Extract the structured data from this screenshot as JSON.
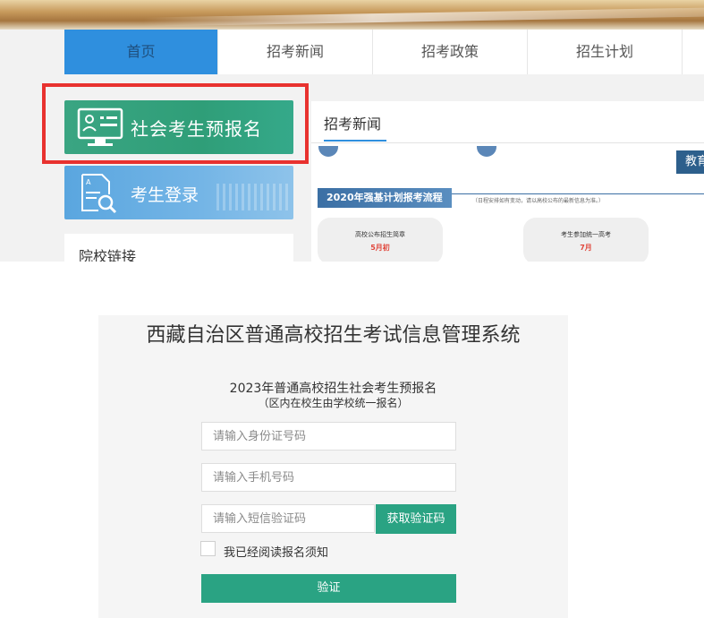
{
  "nav": {
    "items": [
      "首页",
      "招考新闻",
      "招考政策",
      "招生计划"
    ]
  },
  "sidebar": {
    "register_label": "社会考生预报名",
    "login_label": "考生登录",
    "links_title": "院校链接"
  },
  "news": {
    "tab_label": "招考新闻",
    "edu_tag": "教育",
    "flow_title": "2020年强基计划报考流程",
    "flow_note": "（日程安排如有变动，请以高校公布的最新信息为准。）",
    "steps": [
      {
        "title": "高校公布招生简章",
        "date": "5月初"
      },
      {
        "title": "考生参加统一高考",
        "date": "7月"
      }
    ]
  },
  "login_form": {
    "system_title": "西藏自治区普通高校招生考试信息管理系统",
    "form_title": "2023年普通高校招生社会考生预报名",
    "form_subtitle": "（区内在校生由学校统一报名）",
    "id_placeholder": "请输入身份证号码",
    "phone_placeholder": "请输入手机号码",
    "sms_placeholder": "请输入短信验证码",
    "get_code_label": "获取验证码",
    "agree_label": "我已经阅读报名须知",
    "verify_label": "验证"
  },
  "colors": {
    "nav_active": "#2f8fde",
    "register_green": "#2f9e78",
    "login_blue": "#5aa6df",
    "highlight_red": "#e8322f",
    "primary_green": "#2aa383"
  }
}
